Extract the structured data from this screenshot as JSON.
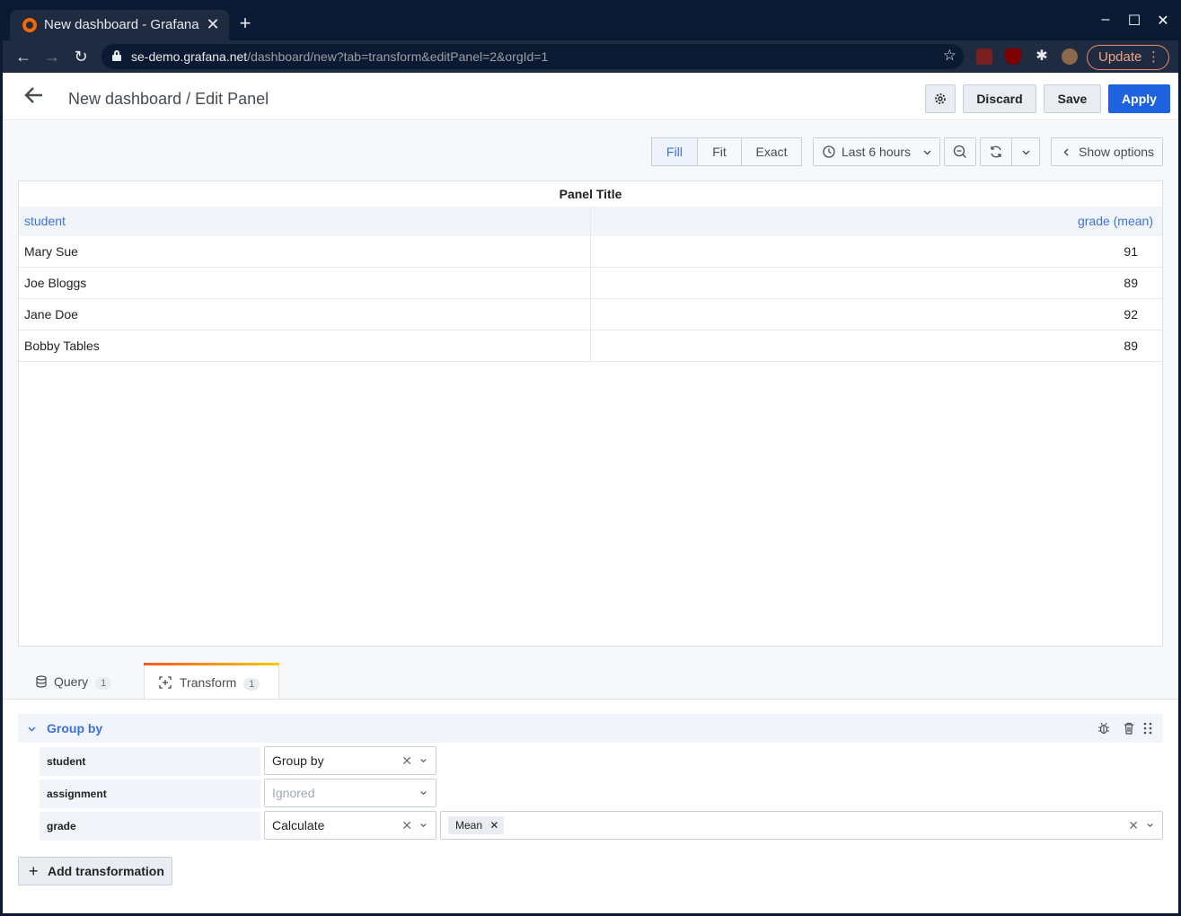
{
  "browser": {
    "tab_title": "New dashboard - Grafana",
    "url_host": "se-demo.grafana.net",
    "url_path": "/dashboard/new?tab=transform&editPanel=2&orgId=1",
    "update_label": "Update"
  },
  "header": {
    "title": "New dashboard / Edit Panel",
    "discard_label": "Discard",
    "save_label": "Save",
    "apply_label": "Apply"
  },
  "toolbar": {
    "fill_label": "Fill",
    "fit_label": "Fit",
    "exact_label": "Exact",
    "active_mode": "Fill",
    "time_range": "Last 6 hours",
    "show_options_label": "Show options"
  },
  "panel": {
    "title": "Panel Title",
    "columns": [
      "student",
      "grade (mean)"
    ],
    "rows": [
      {
        "student": "Mary Sue",
        "grade": "91"
      },
      {
        "student": "Joe Bloggs",
        "grade": "89"
      },
      {
        "student": "Jane Doe",
        "grade": "92"
      },
      {
        "student": "Bobby Tables",
        "grade": "89"
      }
    ]
  },
  "tabs": [
    {
      "label": "Query",
      "count": "1"
    },
    {
      "label": "Transform",
      "count": "1",
      "active": true
    }
  ],
  "transform": {
    "name": "Group by",
    "fields": [
      {
        "field": "student",
        "action": "Group by"
      },
      {
        "field": "assignment",
        "action": "Ignored"
      },
      {
        "field": "grade",
        "action": "Calculate",
        "calculations": [
          "Mean"
        ]
      }
    ],
    "add_label": "Add transformation"
  },
  "colors": {
    "accent_blue": "#3d71d9",
    "primary_button": "#1f62e0",
    "grafana_orange": "#f46800"
  }
}
